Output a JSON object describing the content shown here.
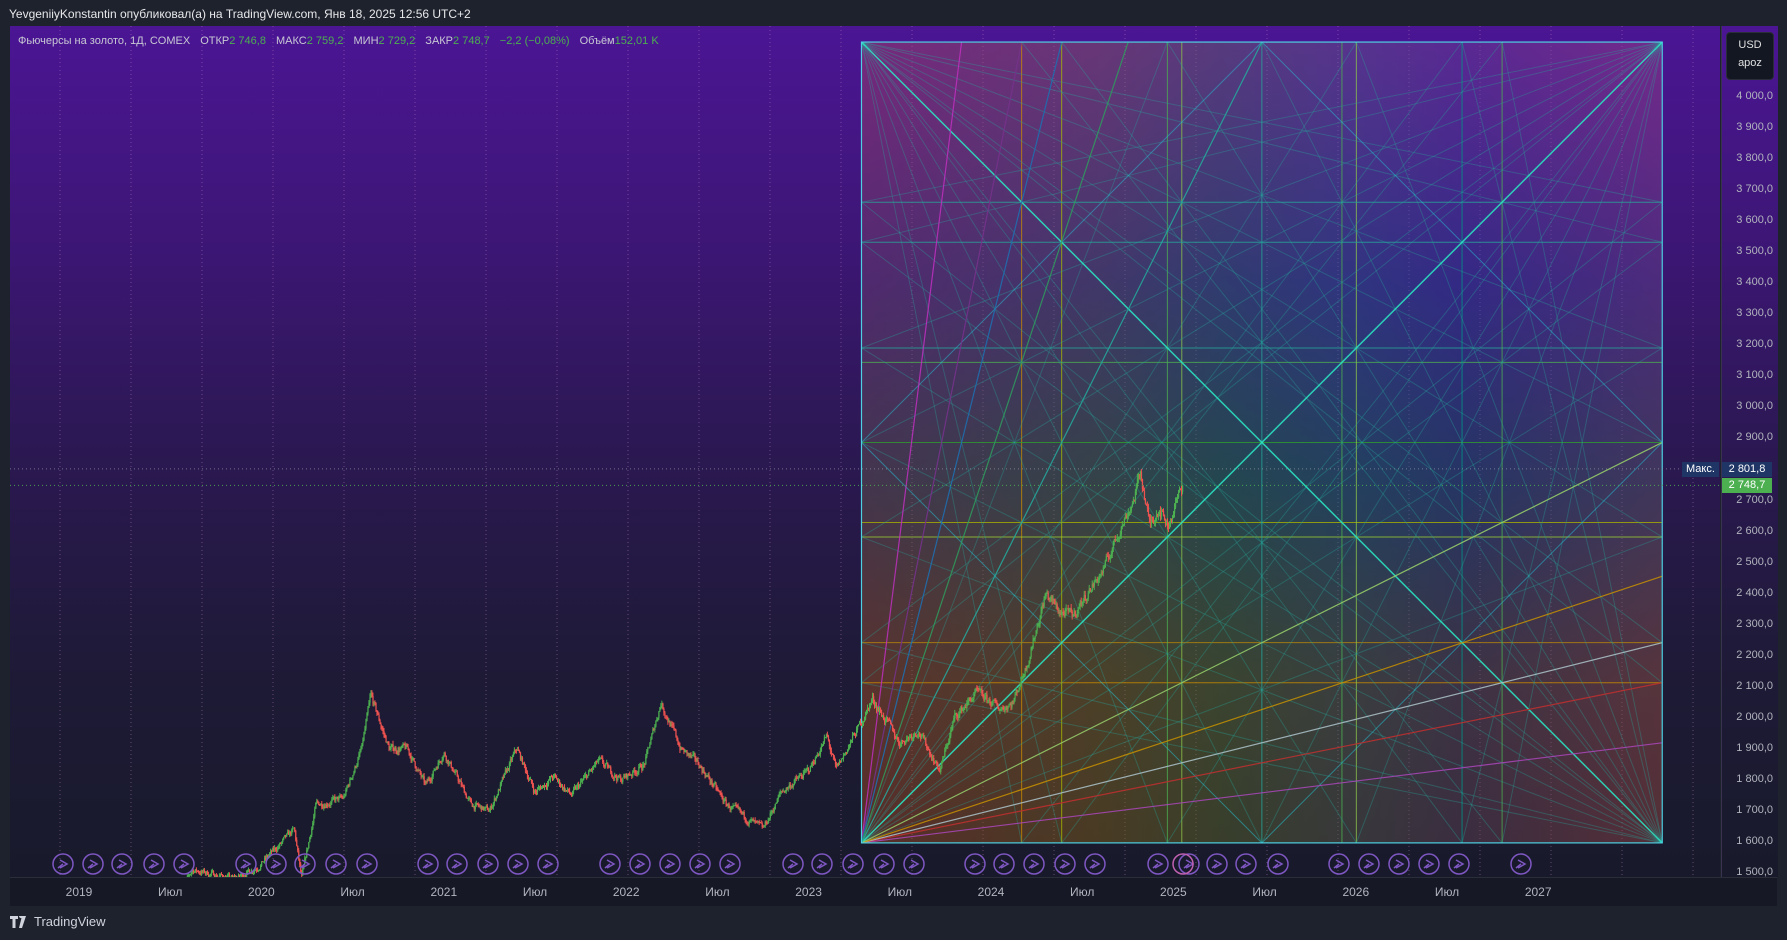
{
  "header": {
    "publish_text": "YevgeniiyKonstantin опубликовал(а) на TradingView.com, Янв 18, 2025 12:56 UTC+2"
  },
  "legend": {
    "symbol": "Фьючерсы на золото, 1Д, COMEX",
    "open_label": "ОТКР",
    "open": "2 746,8",
    "high_label": "МАКС",
    "high": "2 759,2",
    "low_label": "МИН",
    "low": "2 729,2",
    "close_label": "ЗАКР",
    "close": "2 748,7",
    "change": "−2,2 (−0,08%)",
    "volume_label": "Объём",
    "volume": "152,01 K"
  },
  "price_axis": {
    "currency": "USD",
    "unit": "apoz",
    "ticks": [
      "4 000,0",
      "3 900,0",
      "3 800,0",
      "3 700,0",
      "3 600,0",
      "3 500,0",
      "3 400,0",
      "3 300,0",
      "3 200,0",
      "3 100,0",
      "3 000,0",
      "2 900,0",
      "2 700,0",
      "2 600,0",
      "2 500,0",
      "2 400,0",
      "2 300,0",
      "2 200,0",
      "2 100,0",
      "2 000,0",
      "1 900,0",
      "1 800,0",
      "1 700,0",
      "1 600,0",
      "1 500,0"
    ],
    "max_label": "Макс.",
    "max_value": "2 801,8",
    "last_value": "2 748,7"
  },
  "time_axis": {
    "labels": [
      {
        "label": "2019",
        "date": 2019.0
      },
      {
        "label": "Июл",
        "date": 2019.5
      },
      {
        "label": "2020",
        "date": 2020.0
      },
      {
        "label": "Июл",
        "date": 2020.5
      },
      {
        "label": "2021",
        "date": 2021.0
      },
      {
        "label": "Июл",
        "date": 2021.5
      },
      {
        "label": "2022",
        "date": 2022.0
      },
      {
        "label": "Июл",
        "date": 2022.5
      },
      {
        "label": "2023",
        "date": 2023.0
      },
      {
        "label": "Июл",
        "date": 2023.5
      },
      {
        "label": "2024",
        "date": 2024.0
      },
      {
        "label": "Июл",
        "date": 2024.5
      },
      {
        "label": "2025",
        "date": 2025.0
      },
      {
        "label": "Июл",
        "date": 2025.5
      },
      {
        "label": "2026",
        "date": 2026.0
      },
      {
        "label": "Июл",
        "date": 2026.5
      },
      {
        "label": "2027",
        "date": 2027.0
      }
    ]
  },
  "footer": {
    "brand": "TradingView"
  },
  "colors": {
    "up": "#4caf50",
    "down": "#ef5350",
    "event": "#7e57c2",
    "gann_main": "#2be0c0"
  },
  "chart_data": {
    "type": "candlestick",
    "title": "Фьючерсы на золото, 1Д, COMEX",
    "ylim": [
      1500,
      4000
    ],
    "xlim": [
      2018.9,
      2027.95
    ],
    "last_price": 2748.7,
    "max_price": 2801.8,
    "close_waypoints": [
      [
        2019.55,
        1420
      ],
      [
        2019.62,
        1510
      ],
      [
        2019.7,
        1500
      ],
      [
        2019.85,
        1480
      ],
      [
        2019.98,
        1520
      ],
      [
        2020.1,
        1590
      ],
      [
        2020.18,
        1640
      ],
      [
        2020.22,
        1480
      ],
      [
        2020.3,
        1720
      ],
      [
        2020.45,
        1740
      ],
      [
        2020.55,
        1900
      ],
      [
        2020.6,
        2070
      ],
      [
        2020.7,
        1900
      ],
      [
        2020.8,
        1900
      ],
      [
        2020.9,
        1780
      ],
      [
        2021.0,
        1890
      ],
      [
        2021.15,
        1720
      ],
      [
        2021.25,
        1700
      ],
      [
        2021.4,
        1900
      ],
      [
        2021.5,
        1760
      ],
      [
        2021.6,
        1810
      ],
      [
        2021.7,
        1750
      ],
      [
        2021.85,
        1860
      ],
      [
        2021.97,
        1800
      ],
      [
        2022.1,
        1850
      ],
      [
        2022.19,
        2050
      ],
      [
        2022.3,
        1900
      ],
      [
        2022.4,
        1850
      ],
      [
        2022.55,
        1720
      ],
      [
        2022.75,
        1640
      ],
      [
        2022.85,
        1760
      ],
      [
        2023.0,
        1830
      ],
      [
        2023.1,
        1940
      ],
      [
        2023.15,
        1830
      ],
      [
        2023.3,
        2000
      ],
      [
        2023.35,
        2060
      ],
      [
        2023.5,
        1920
      ],
      [
        2023.6,
        1960
      ],
      [
        2023.72,
        1830
      ],
      [
        2023.8,
        2000
      ],
      [
        2023.92,
        2080
      ],
      [
        2024.05,
        2030
      ],
      [
        2024.12,
        2050
      ],
      [
        2024.2,
        2180
      ],
      [
        2024.3,
        2400
      ],
      [
        2024.38,
        2340
      ],
      [
        2024.45,
        2330
      ],
      [
        2024.55,
        2420
      ],
      [
        2024.62,
        2480
      ],
      [
        2024.7,
        2600
      ],
      [
        2024.78,
        2700
      ],
      [
        2024.82,
        2790
      ],
      [
        2024.87,
        2620
      ],
      [
        2024.92,
        2680
      ],
      [
        2024.97,
        2620
      ],
      [
        2025.05,
        2748
      ]
    ],
    "gann_box": {
      "start": 2023.29,
      "end": 2027.68,
      "low": 1597,
      "high": 4177,
      "levels": [
        0.2,
        0.25,
        0.382,
        0.4,
        0.5,
        0.6,
        0.618,
        0.75,
        0.8
      ],
      "fan_ratios": [
        0.125,
        0.2,
        0.25,
        0.333,
        0.5,
        1
      ]
    }
  }
}
